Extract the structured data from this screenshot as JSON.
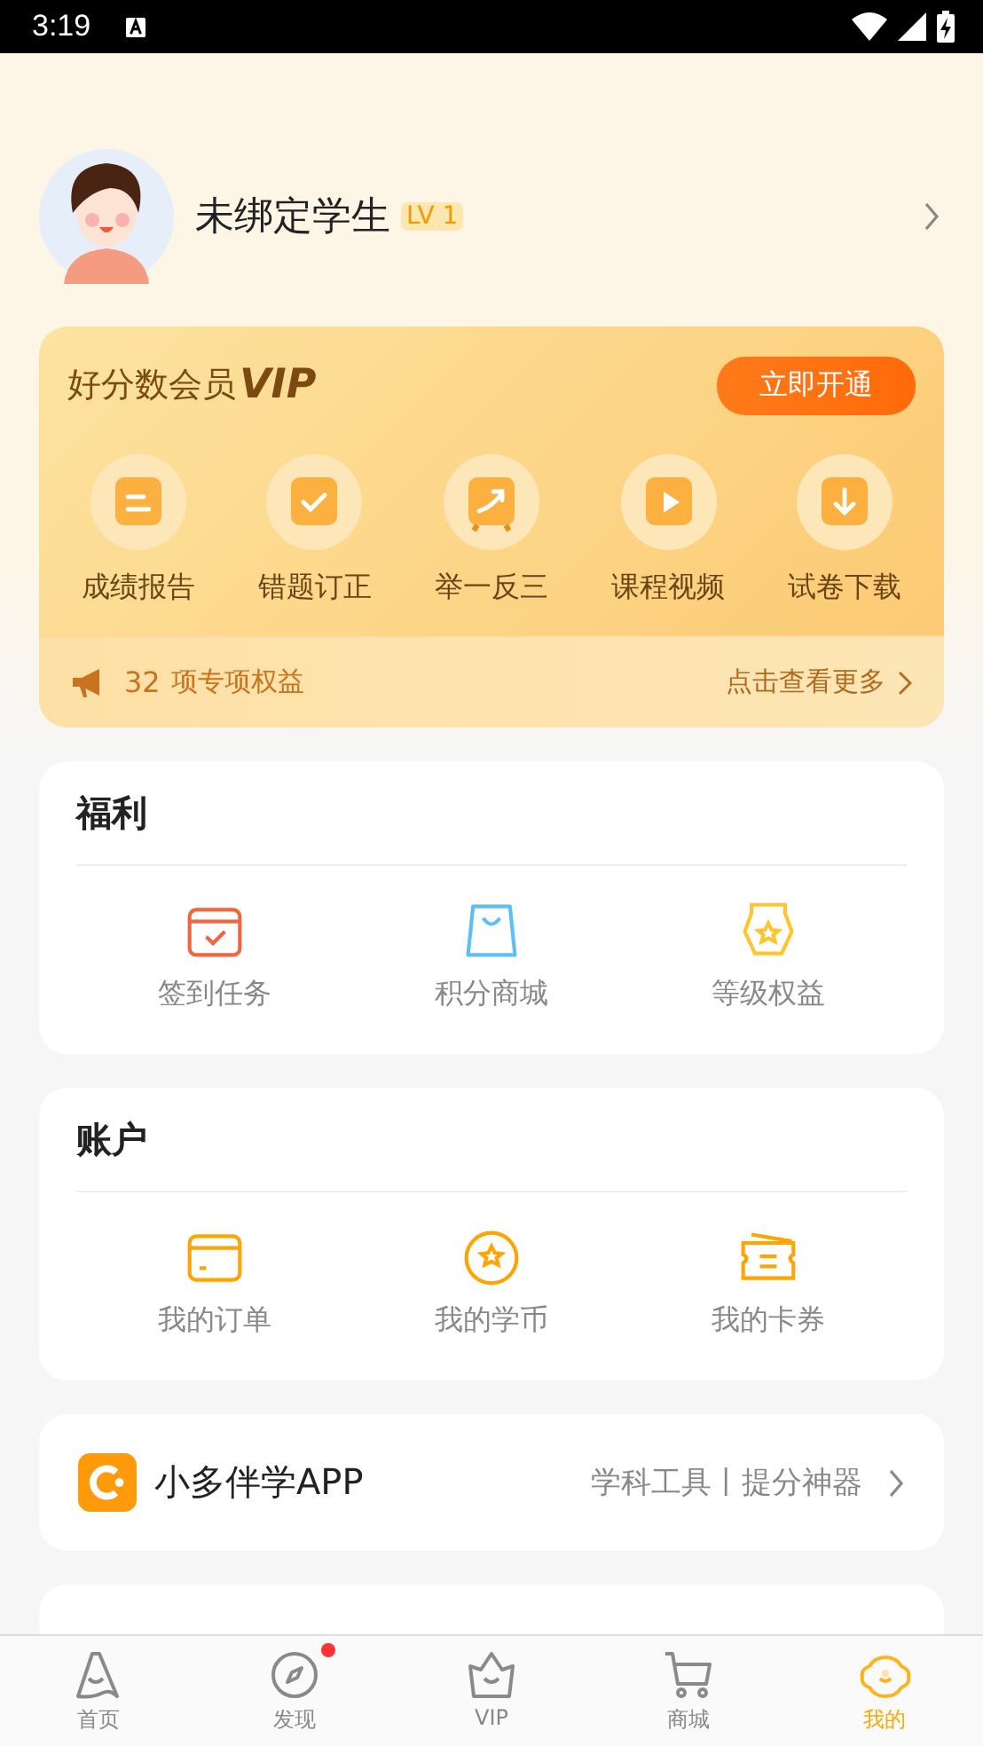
{
  "status_bar": {
    "time": "3:19"
  },
  "profile": {
    "name": "未绑定学生",
    "level": "LV 1"
  },
  "vip": {
    "title": "好分数会员",
    "brand": "VIP",
    "button": "立即开通",
    "features": [
      {
        "kind": "report",
        "label": "成绩报告"
      },
      {
        "kind": "check",
        "label": "错题订正"
      },
      {
        "kind": "trend",
        "label": "举一反三"
      },
      {
        "kind": "video",
        "label": "课程视频"
      },
      {
        "kind": "download",
        "label": "试卷下载"
      }
    ],
    "benefits": {
      "count": "32",
      "text": "项专项权益",
      "more": "点击查看更多"
    }
  },
  "sections": [
    {
      "title": "福利",
      "items": [
        {
          "kind": "calendar",
          "label": "签到任务"
        },
        {
          "kind": "bag",
          "label": "积分商城"
        },
        {
          "kind": "medal",
          "label": "等级权益"
        }
      ]
    },
    {
      "title": "账户",
      "items": [
        {
          "kind": "card",
          "label": "我的订单"
        },
        {
          "kind": "coin",
          "label": "我的学币"
        },
        {
          "kind": "ticket",
          "label": "我的卡券"
        }
      ]
    }
  ],
  "app_promo": {
    "name": "小多伴学APP",
    "tagline": "学科工具丨提分神器"
  },
  "tab_bar": [
    {
      "kind": "home",
      "label": "首页",
      "selected": false,
      "dot": false
    },
    {
      "kind": "discover",
      "label": "发现",
      "selected": false,
      "dot": true
    },
    {
      "kind": "vip",
      "label": "VIP",
      "selected": false,
      "dot": false
    },
    {
      "kind": "shop",
      "label": "商城",
      "selected": false,
      "dot": false
    },
    {
      "kind": "me",
      "label": "我的",
      "selected": true,
      "dot": false
    }
  ]
}
